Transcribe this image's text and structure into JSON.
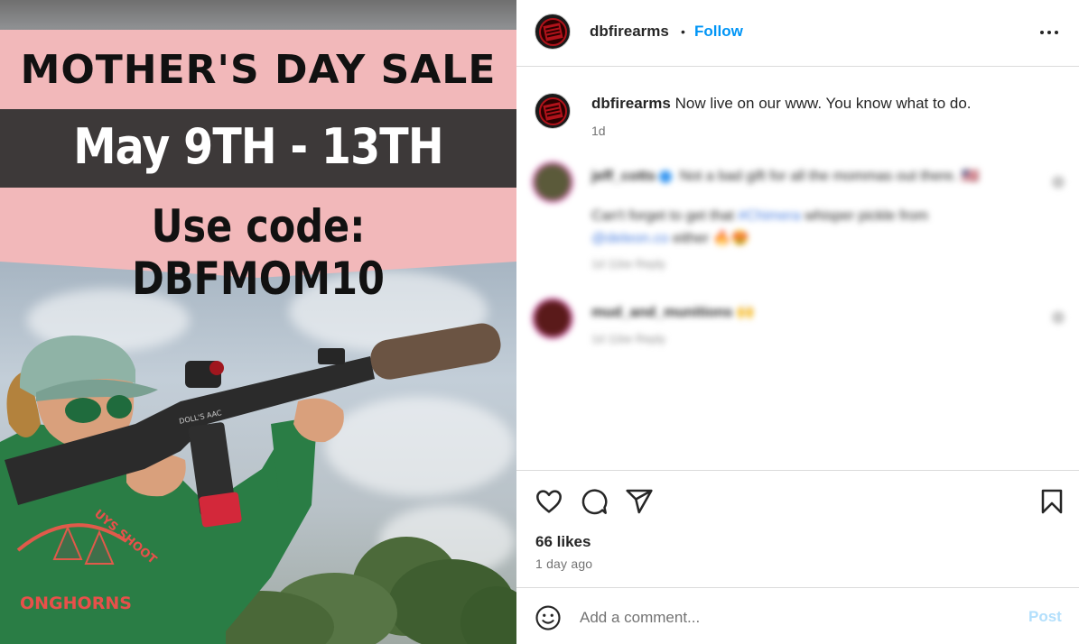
{
  "image": {
    "sale_title": "MOTHER'S DAY SALE",
    "dates": "May 9TH - 13TH",
    "code_line": "Use code: DBFMOM10",
    "shirt_text_1": "ONGHORNS",
    "shirt_text_2": "UYS SHOOT",
    "rifle_text": "DOLL'S AAC"
  },
  "header": {
    "username": "dbfirearms",
    "separator": "•",
    "follow_label": "Follow",
    "more_icon": "more-options-icon"
  },
  "caption": {
    "username": "dbfirearms",
    "text": " Now live on our www. You know what to do.",
    "age": "1d"
  },
  "comments": [
    {
      "username": "jeff_cotts",
      "text": " Not a bad gift for all the mommas out there. 🇺🇸",
      "line2": "Can't forget to get that ",
      "link1": "#Chimera",
      "line2b": " whisper pickle from",
      "link2": "@deleon.co",
      "line3": " either 🔥😍",
      "meta": "1d   11ke   Reply"
    },
    {
      "username": "mud_and_munitions",
      "text": " 🙌",
      "meta": "1d   11ke   Reply"
    }
  ],
  "actions": {
    "like_icon": "heart-icon",
    "comment_icon": "comment-icon",
    "share_icon": "share-icon",
    "save_icon": "bookmark-icon",
    "likes": "66 likes",
    "time_ago": "1 day ago"
  },
  "add_comment": {
    "placeholder": "Add a comment...",
    "post_label": "Post",
    "emoji_icon": "emoji-icon"
  },
  "colors": {
    "accent": "#0095f6",
    "post_disabled": "#b2dffc",
    "banner_pink": "#f2b8ba",
    "banner_dark": "#3d3939"
  }
}
